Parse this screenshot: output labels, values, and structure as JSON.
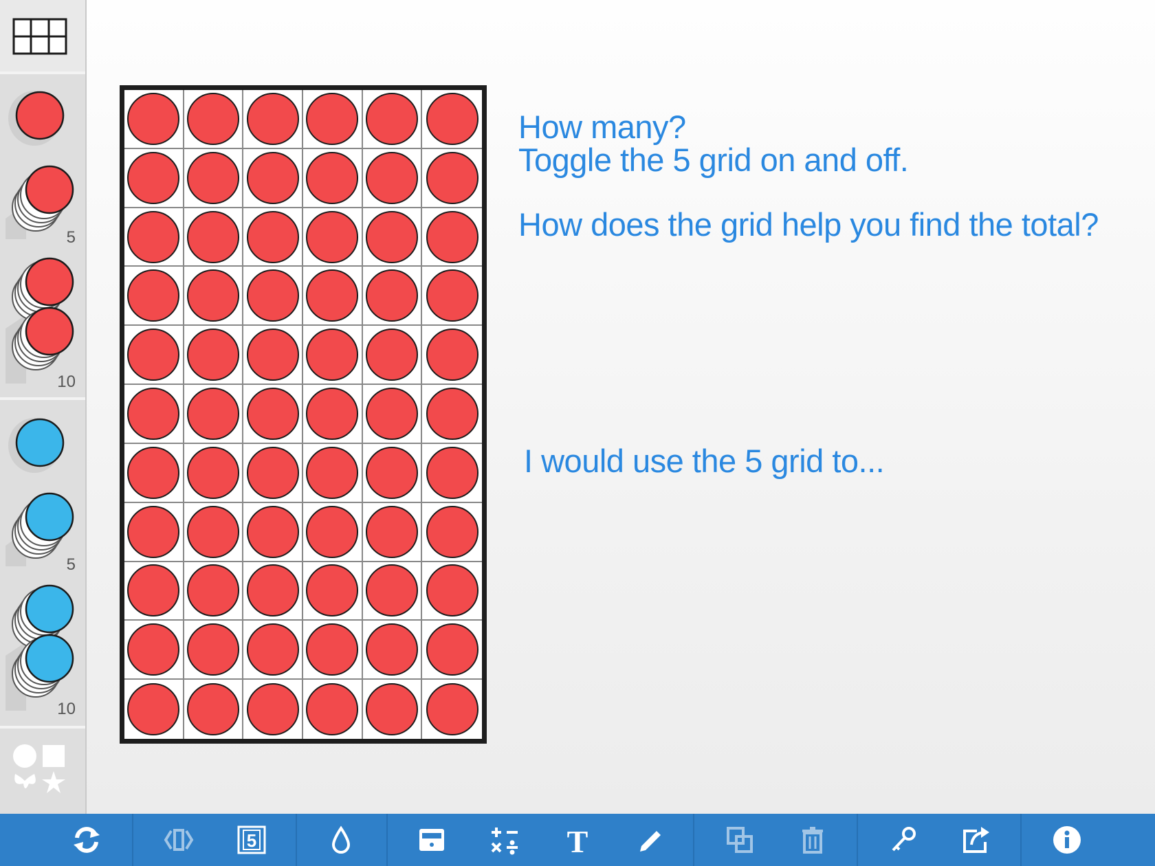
{
  "sidebar": {
    "grid_toggle_icon": "grid-icon",
    "stacks": [
      {
        "color": "#f24a4c",
        "count_label": "5"
      },
      {
        "color": "#f24a4c",
        "count_label": "10"
      },
      {
        "color": "#3bb6ea",
        "count_label": "5"
      },
      {
        "color": "#3bb6ea",
        "count_label": "10"
      }
    ],
    "shapes_icon": "shapes-icon"
  },
  "board": {
    "columns": 6,
    "rows": 11,
    "counter_color": "#f24a4c"
  },
  "prompts": {
    "line1": "How many?",
    "line2": "Toggle the 5 grid on and off.",
    "line3": "How does the grid help you find the total?",
    "line4": "I would use the 5 grid to..."
  },
  "toolbar": {
    "color": "#2f80c9",
    "buttons": [
      "refresh-icon",
      "flip-icon",
      "five-grid-icon",
      "color-drop-icon",
      "calculator-icon",
      "math-operations-icon",
      "text-icon",
      "pen-icon",
      "copy-icon",
      "trash-icon",
      "key-icon",
      "share-icon",
      "info-icon"
    ]
  }
}
